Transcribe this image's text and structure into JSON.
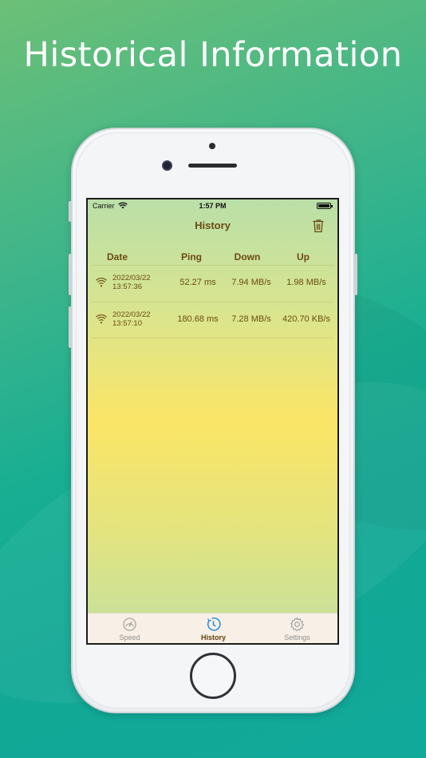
{
  "promo": {
    "headline": "Historical Information"
  },
  "status_bar": {
    "carrier": "Carrier",
    "time": "1:57 PM"
  },
  "nav": {
    "title": "History",
    "trash_icon": "trash-icon"
  },
  "table": {
    "headers": {
      "date": "Date",
      "ping": "Ping",
      "down": "Down",
      "up": "Up"
    },
    "rows": [
      {
        "date": "2022/03/22",
        "time": "13:57:36",
        "ping": "52.27 ms",
        "down": "7.94 MB/s",
        "up": "1.98 MB/s",
        "icon": "wifi-icon"
      },
      {
        "date": "2022/03/22",
        "time": "13:57:10",
        "ping": "180.68 ms",
        "down": "7.28 MB/s",
        "up": "420.70 KB/s",
        "icon": "wifi-icon"
      }
    ]
  },
  "tabbar": {
    "tabs": [
      {
        "label": "Speed",
        "icon": "speedometer-icon",
        "active": false
      },
      {
        "label": "History",
        "icon": "history-clock-icon",
        "active": true
      },
      {
        "label": "Settings",
        "icon": "gear-icon",
        "active": false
      }
    ]
  },
  "colors": {
    "accent": "#1a88d8",
    "text_brown": "#6b4a13",
    "tab_inactive": "#8e8e8e"
  }
}
